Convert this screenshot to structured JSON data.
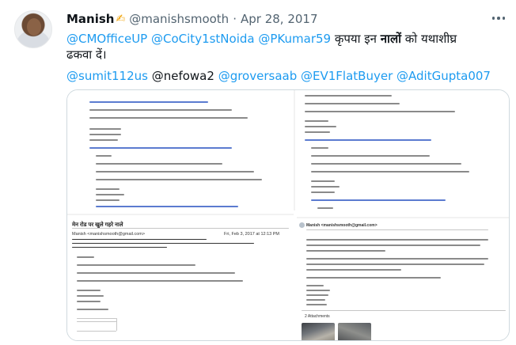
{
  "author": {
    "name": "Manish",
    "signature_emoji": "✍",
    "handle": "@manishsmooth",
    "separator": "·",
    "date": "Apr 28, 2017"
  },
  "tweet": {
    "line1": {
      "m1": "@CMOfficeUP",
      "m2": "@CoCity1stNoida",
      "m3": "@PKumar59",
      "text_before_bold": "कृपया इन",
      "bold_word": "नालों",
      "text_after_bold": "को यथाशीघ्र"
    },
    "line2": "ढकवा दें।",
    "mentions_row": {
      "m1": "@sumit112us",
      "m2": "@nefowa2",
      "m3": "@groversaab",
      "m4": "@EV1FlatBuyer",
      "m5": "@AditGupta007"
    }
  },
  "media": {
    "email_subject": "मेन रोड पर खुले गहरे नाले",
    "email_from": "Manish <manishsmooth@gmail.com>",
    "email_date": "Fri, Feb 3, 2017 at 12:13 PM",
    "attachments_label": "2 Attachments"
  },
  "colors": {
    "link": "#1d9bf0",
    "text": "#0f1419",
    "muted": "#536471",
    "border": "#cfd9de"
  },
  "icons": {
    "more": "more-horizontal-icon"
  }
}
